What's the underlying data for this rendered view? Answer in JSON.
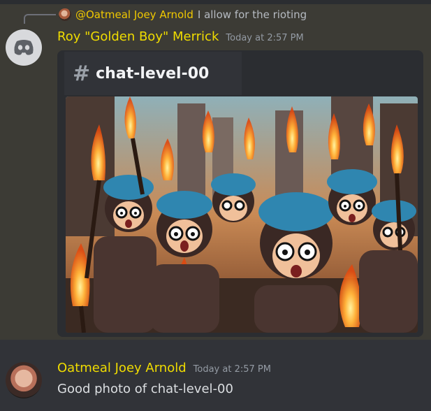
{
  "reply": {
    "author": "@Oatmeal Joey Arnold",
    "text": "I allow for the rioting"
  },
  "message1": {
    "author": "Roy \"Golden Boy\" Merrick",
    "timestamp": "Today at 2:57 PM",
    "avatar_icon": "discord-default-avatar-icon"
  },
  "embed": {
    "channel_hash": "#",
    "channel_name": "chat-level-00",
    "image_alt": "Cartoon crowd of kids in beanies and glasses holding torches in a burning city"
  },
  "message2": {
    "author": "Oatmeal Joey Arnold",
    "timestamp": "Today at 2:57 PM",
    "text": "Good photo of chat-level-00"
  },
  "colors": {
    "background": "#313338",
    "highlight": "#3c3b35",
    "username": "#f0dc00",
    "reply_username": "#f0c800",
    "timestamp": "#949ba4",
    "embed_bg": "#2b2d31"
  }
}
